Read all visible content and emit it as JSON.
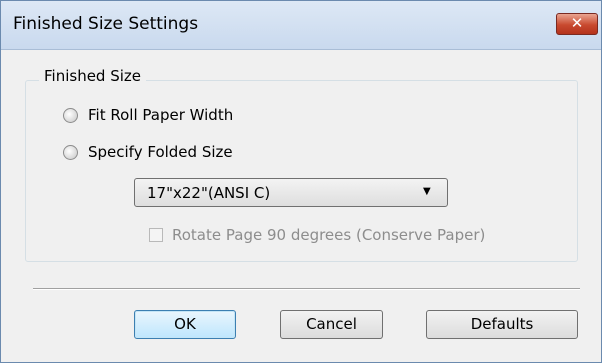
{
  "window": {
    "title": "Finished Size Settings",
    "close_glyph": "✕"
  },
  "finished_size": {
    "group_title": "Finished Size",
    "options": [
      {
        "label": "Fit Roll Paper Width",
        "selected": false
      },
      {
        "label": "Specify Folded Size",
        "selected": false
      }
    ],
    "size_select": {
      "value": "17\"x22\"(ANSI C)",
      "arrow_glyph": "▼"
    },
    "rotate_checkbox": {
      "label": "Rotate Page 90 degrees (Conserve Paper)",
      "checked": false,
      "enabled": false
    }
  },
  "buttons": {
    "ok": "OK",
    "cancel": "Cancel",
    "defaults": "Defaults"
  },
  "colors": {
    "title_bar": "#c9d9ee",
    "close_button": "#c8492f",
    "dialog_background": "#f0f0f0",
    "default_button_border": "#3c7fb1"
  }
}
